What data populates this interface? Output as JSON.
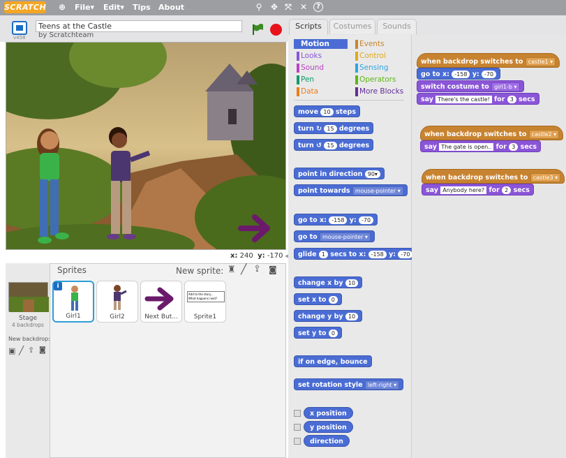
{
  "menu": {
    "logo": "SCRATCH",
    "file": "File▾",
    "edit": "Edit▾",
    "tips": "Tips",
    "about": "About"
  },
  "project": {
    "title": "Teens at the Castle",
    "author": "by Scratchteam",
    "version": "v458"
  },
  "stage_coords": {
    "x_label": "x:",
    "x": "240",
    "y_label": "y:",
    "y": "-170"
  },
  "sprites_pane": {
    "title": "Sprites",
    "new_sprite": "New sprite:",
    "stage_label": "Stage",
    "stage_backdrops": "4 backdrops",
    "new_backdrop": "New backdrop:",
    "sprites": [
      {
        "name": "Girl1"
      },
      {
        "name": "Girl2"
      },
      {
        "name": "Next But..."
      },
      {
        "name": "Sprite1",
        "preview": "Add to the story...\nWhat happens next?"
      }
    ]
  },
  "tabs": [
    "Scripts",
    "Costumes",
    "Sounds"
  ],
  "categories": {
    "left": [
      "Motion",
      "Looks",
      "Sound",
      "Pen",
      "Data"
    ],
    "right": [
      "Events",
      "Control",
      "Sensing",
      "Operators",
      "More Blocks"
    ]
  },
  "palette": {
    "move": {
      "a": "move",
      "v": "10",
      "b": "steps"
    },
    "turn_right": {
      "a": "turn",
      "v": "15",
      "b": "degrees"
    },
    "turn_left": {
      "a": "turn",
      "v": "15",
      "b": "degrees"
    },
    "point_dir": {
      "a": "point in direction",
      "v": "90▾"
    },
    "point_towards": {
      "a": "point towards",
      "v": "mouse-pointer ▾"
    },
    "goto_xy": {
      "a": "go to x:",
      "x": "-158",
      "b": "y:",
      "y": "-70"
    },
    "goto": {
      "a": "go to",
      "v": "mouse-pointer ▾"
    },
    "glide": {
      "a": "glide",
      "s": "1",
      "b": "secs to x:",
      "x": "-158",
      "c": "y:",
      "y": "-70"
    },
    "change_x": {
      "a": "change x by",
      "v": "10"
    },
    "set_x": {
      "a": "set x to",
      "v": "0"
    },
    "change_y": {
      "a": "change y by",
      "v": "10"
    },
    "set_y": {
      "a": "set y to",
      "v": "0"
    },
    "bounce": "if on edge, bounce",
    "rotation": {
      "a": "set rotation style",
      "v": "left-right ▾"
    },
    "reporters": [
      "x position",
      "y position",
      "direction"
    ]
  },
  "scripts": [
    {
      "hat": "when backdrop switches to",
      "backdrop": "castle1 ▾",
      "goto": {
        "a": "go to x:",
        "x": "-158",
        "b": "y:",
        "y": "-70"
      },
      "costume": {
        "a": "switch costume to",
        "v": "girl1-b ▾"
      },
      "say": {
        "a": "say",
        "text": "There's the castle!",
        "b": "for",
        "n": "3",
        "c": "secs"
      }
    },
    {
      "hat": "when backdrop switches to",
      "backdrop": "castle2 ▾",
      "say": {
        "a": "say",
        "text": "The gate is open..",
        "b": "for",
        "n": "3",
        "c": "secs"
      }
    },
    {
      "hat": "when backdrop switches to",
      "backdrop": "castle3 ▾",
      "say": {
        "a": "say",
        "text": "Anybody here?",
        "b": "for",
        "n": "2",
        "c": "secs"
      }
    }
  ],
  "colors": {
    "motion": "#4a6cd4",
    "looks": "#8a55d7",
    "events": "#c88330",
    "arrow": "#6b1a6b"
  }
}
